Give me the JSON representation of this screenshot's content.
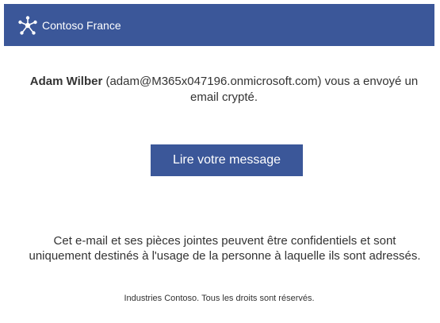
{
  "header": {
    "brand_name": "Contoso France",
    "logo_icon": "network-hub-icon",
    "background_color": "#3b5799"
  },
  "message": {
    "sender_name": "Adam Wilber",
    "sender_email": "(adam@M365x047196.onmicrosoft.com)",
    "text_before_break": "vous a envoyé un",
    "text_after_break": "email crypté."
  },
  "action": {
    "read_button_label": "Lire votre message",
    "button_color": "#3b5799"
  },
  "disclaimer": {
    "line1": "Cet e-mail et ses pièces jointes peuvent être confidentiels et sont",
    "line2": "uniquement destinés à l'usage de la personne à laquelle ils sont adressés."
  },
  "footer": {
    "copyright": "Industries Contoso. Tous les droits sont réservés."
  }
}
